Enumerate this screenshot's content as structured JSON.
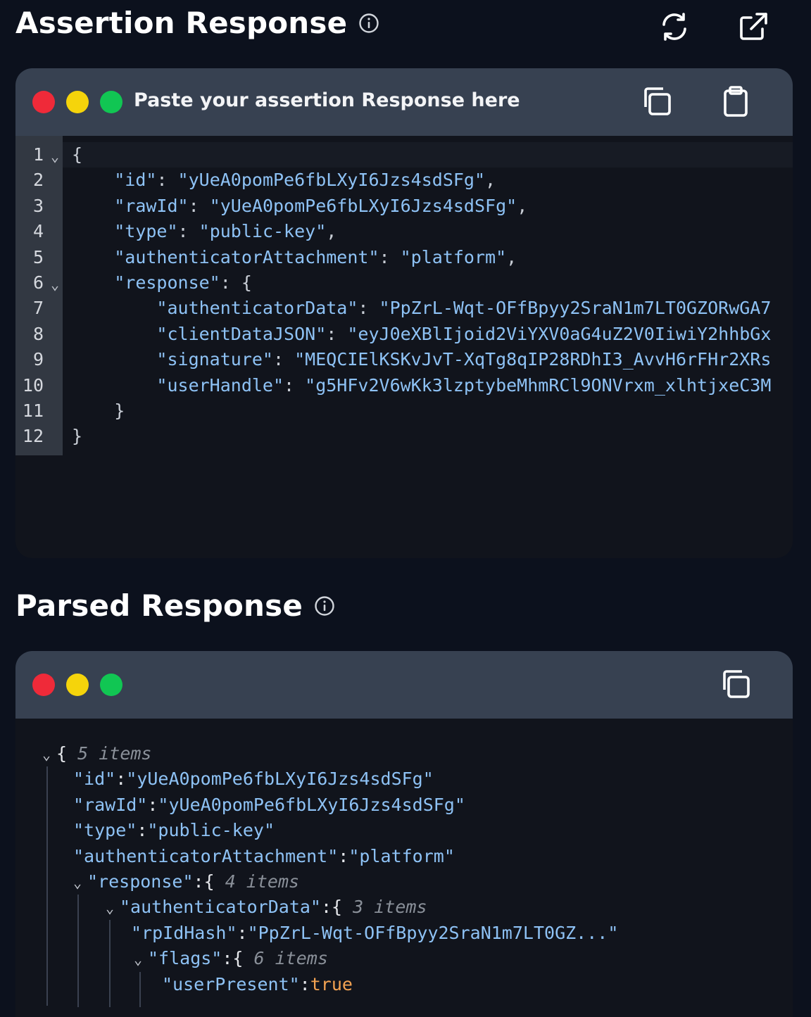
{
  "assertion": {
    "title": "Assertion Response",
    "header_title": "Paste your assertion Response here",
    "lines": [
      {
        "n": "1",
        "fold": true,
        "indent": "",
        "parts": [
          [
            "p",
            "{"
          ]
        ]
      },
      {
        "n": "2",
        "fold": false,
        "indent": "    ",
        "parts": [
          [
            "k",
            "\"id\""
          ],
          [
            "p",
            ": "
          ],
          [
            "s",
            "\"yUeA0pomPe6fbLXyI6Jzs4sdSFg\""
          ],
          [
            "p",
            ","
          ]
        ]
      },
      {
        "n": "3",
        "fold": false,
        "indent": "    ",
        "parts": [
          [
            "k",
            "\"rawId\""
          ],
          [
            "p",
            ": "
          ],
          [
            "s",
            "\"yUeA0pomPe6fbLXyI6Jzs4sdSFg\""
          ],
          [
            "p",
            ","
          ]
        ]
      },
      {
        "n": "4",
        "fold": false,
        "indent": "    ",
        "parts": [
          [
            "k",
            "\"type\""
          ],
          [
            "p",
            ": "
          ],
          [
            "s",
            "\"public-key\""
          ],
          [
            "p",
            ","
          ]
        ]
      },
      {
        "n": "5",
        "fold": false,
        "indent": "    ",
        "parts": [
          [
            "k",
            "\"authenticatorAttachment\""
          ],
          [
            "p",
            ": "
          ],
          [
            "s",
            "\"platform\""
          ],
          [
            "p",
            ","
          ]
        ]
      },
      {
        "n": "6",
        "fold": true,
        "indent": "    ",
        "parts": [
          [
            "k",
            "\"response\""
          ],
          [
            "p",
            ": {"
          ]
        ]
      },
      {
        "n": "7",
        "fold": false,
        "indent": "        ",
        "parts": [
          [
            "k",
            "\"authenticatorData\""
          ],
          [
            "p",
            ": "
          ],
          [
            "s",
            "\"PpZrL-Wqt-OFfBpyy2SraN1m7LT0GZORwGA7"
          ]
        ]
      },
      {
        "n": "8",
        "fold": false,
        "indent": "        ",
        "parts": [
          [
            "k",
            "\"clientDataJSON\""
          ],
          [
            "p",
            ": "
          ],
          [
            "s",
            "\"eyJ0eXBlIjoid2ViYXV0aG4uZ2V0IiwiY2hhbGx"
          ]
        ]
      },
      {
        "n": "9",
        "fold": false,
        "indent": "        ",
        "parts": [
          [
            "k",
            "\"signature\""
          ],
          [
            "p",
            ": "
          ],
          [
            "s",
            "\"MEQCIElKSKvJvT-XqTg8qIP28RDhI3_AvvH6rFHr2XRs"
          ]
        ]
      },
      {
        "n": "10",
        "fold": false,
        "indent": "        ",
        "parts": [
          [
            "k",
            "\"userHandle\""
          ],
          [
            "p",
            ": "
          ],
          [
            "s",
            "\"g5HFv2V6wKk3lzptybeMhmRCl9ONVrxm_xlhtjxeC3M"
          ]
        ]
      },
      {
        "n": "11",
        "fold": false,
        "indent": "    ",
        "parts": [
          [
            "p",
            "}"
          ]
        ]
      },
      {
        "n": "12",
        "fold": false,
        "indent": "",
        "parts": [
          [
            "p",
            "}"
          ]
        ]
      }
    ]
  },
  "parsed": {
    "title": "Parsed Response",
    "rows": [
      {
        "caret": true,
        "key": "",
        "open": "{",
        "count": "5 items"
      },
      {
        "caret": false,
        "key": "\"id\"",
        "value": "\"yUeA0pomPe6fbLXyI6Jzs4sdSFg\""
      },
      {
        "caret": false,
        "key": "\"rawId\"",
        "value": "\"yUeA0pomPe6fbLXyI6Jzs4sdSFg\""
      },
      {
        "caret": false,
        "key": "\"type\"",
        "value": "\"public-key\""
      },
      {
        "caret": false,
        "key": "\"authenticatorAttachment\"",
        "value": "\"platform\""
      },
      {
        "caret": true,
        "key": "\"response\"",
        "open": "{",
        "count": "4 items"
      },
      {
        "caret": true,
        "key": "\"authenticatorData\"",
        "open": "{",
        "count": "3 items"
      },
      {
        "caret": false,
        "key": "\"rpIdHash\"",
        "value": "\"PpZrL-Wqt-OFfBpyy2SraN1m7LT0GZ...\""
      },
      {
        "caret": true,
        "key": "\"flags\"",
        "open": "{",
        "count": "6 items"
      },
      {
        "caret": false,
        "key": "\"userPresent\"",
        "bool": "true"
      }
    ]
  },
  "icons": {
    "info": "info-icon",
    "refresh": "refresh-icon",
    "open_external": "external-link-icon",
    "copy": "copy-icon",
    "paste": "clipboard-icon",
    "fold": "chevron-down-icon"
  },
  "colors": {
    "background": "#0c111d",
    "panel_header": "#374151",
    "editor_bg": "#11141c",
    "key_string": "#8ec2f5",
    "boolean": "#f4a352",
    "dot_red": "#ef2a39",
    "dot_yellow": "#f5d40b",
    "dot_green": "#11c653"
  }
}
